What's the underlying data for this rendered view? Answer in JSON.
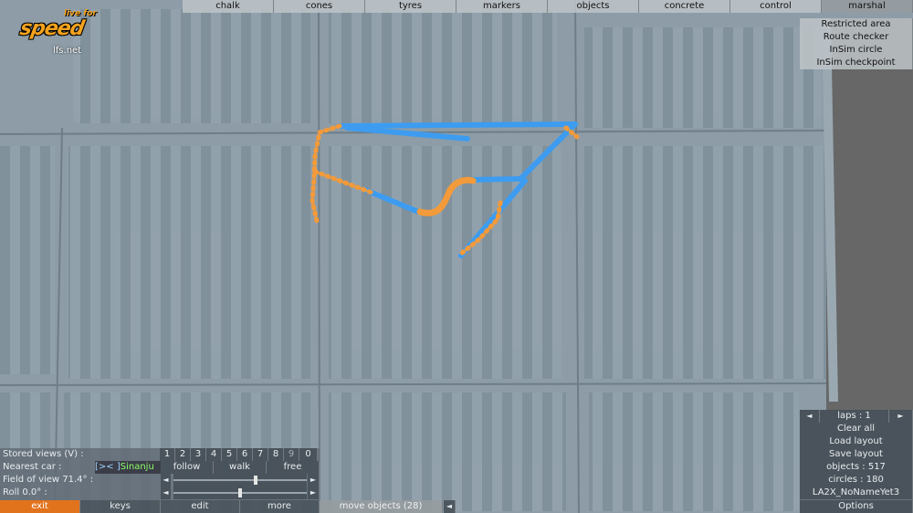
{
  "logo": {
    "line1": "live for",
    "line2": "speed",
    "site": "lfs.net"
  },
  "top_tabs": [
    "chalk",
    "cones",
    "tyres",
    "markers",
    "objects",
    "concrete",
    "control",
    "marshal"
  ],
  "top_tabs_selected": "marshal",
  "marshal_menu": [
    "Restricted area",
    "Route checker",
    "InSim circle",
    "InSim checkpoint"
  ],
  "view_panel": {
    "stored_views_label": "Stored views (V) :",
    "view_numbers": [
      "1",
      "2",
      "3",
      "4",
      "5",
      "6",
      "7",
      "8",
      "9",
      "0"
    ],
    "nearest_car_label": "Nearest car :",
    "nearest_car_name": "[>< ]Sinanju",
    "follow_label": "follow",
    "walk_label": "walk",
    "free_label": "free",
    "fov_label": "Field of view 71.4° :",
    "roll_label": "Roll 0.0° :",
    "left_arrow": "◄",
    "right_arrow": "►",
    "fov_fraction": 0.62,
    "roll_fraction": 0.5
  },
  "bottom_bar": {
    "exit": "exit",
    "keys": "keys",
    "edit": "edit",
    "more": "more",
    "move_objects": "move objects (28)",
    "collapse_arrow": "◄"
  },
  "right_panel": {
    "laps_label": "laps : 1",
    "left_arrow": "◄",
    "right_arrow": "►",
    "clear_all": "Clear all",
    "load_layout": "Load layout",
    "save_layout": "Save layout",
    "objects": "objects : 517",
    "circles": "circles : 180",
    "layout_name": "LA2X_NoNameYet3",
    "options": "Options"
  },
  "colors": {
    "blue_objects": "#3d9cf0",
    "orange_objects": "#f39a3a",
    "ground": "#8a9aa6"
  }
}
